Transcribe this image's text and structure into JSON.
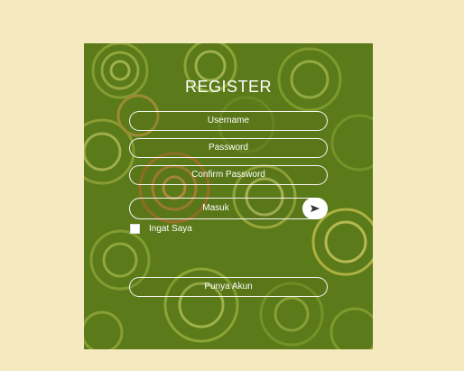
{
  "form": {
    "title": "REGISTER",
    "username_placeholder": "Username",
    "password_placeholder": "Password",
    "confirm_password_placeholder": "Confirm Password",
    "submit_label": "Masuk",
    "submit_icon": "send-arrow-icon",
    "remember_label": "Ingat Saya",
    "remember_checked": false,
    "have_account_label": "Punya Akun"
  },
  "colors": {
    "page_background": "#f5e9bf",
    "card_background": "#5b7a1a",
    "text": "#ffffff"
  }
}
